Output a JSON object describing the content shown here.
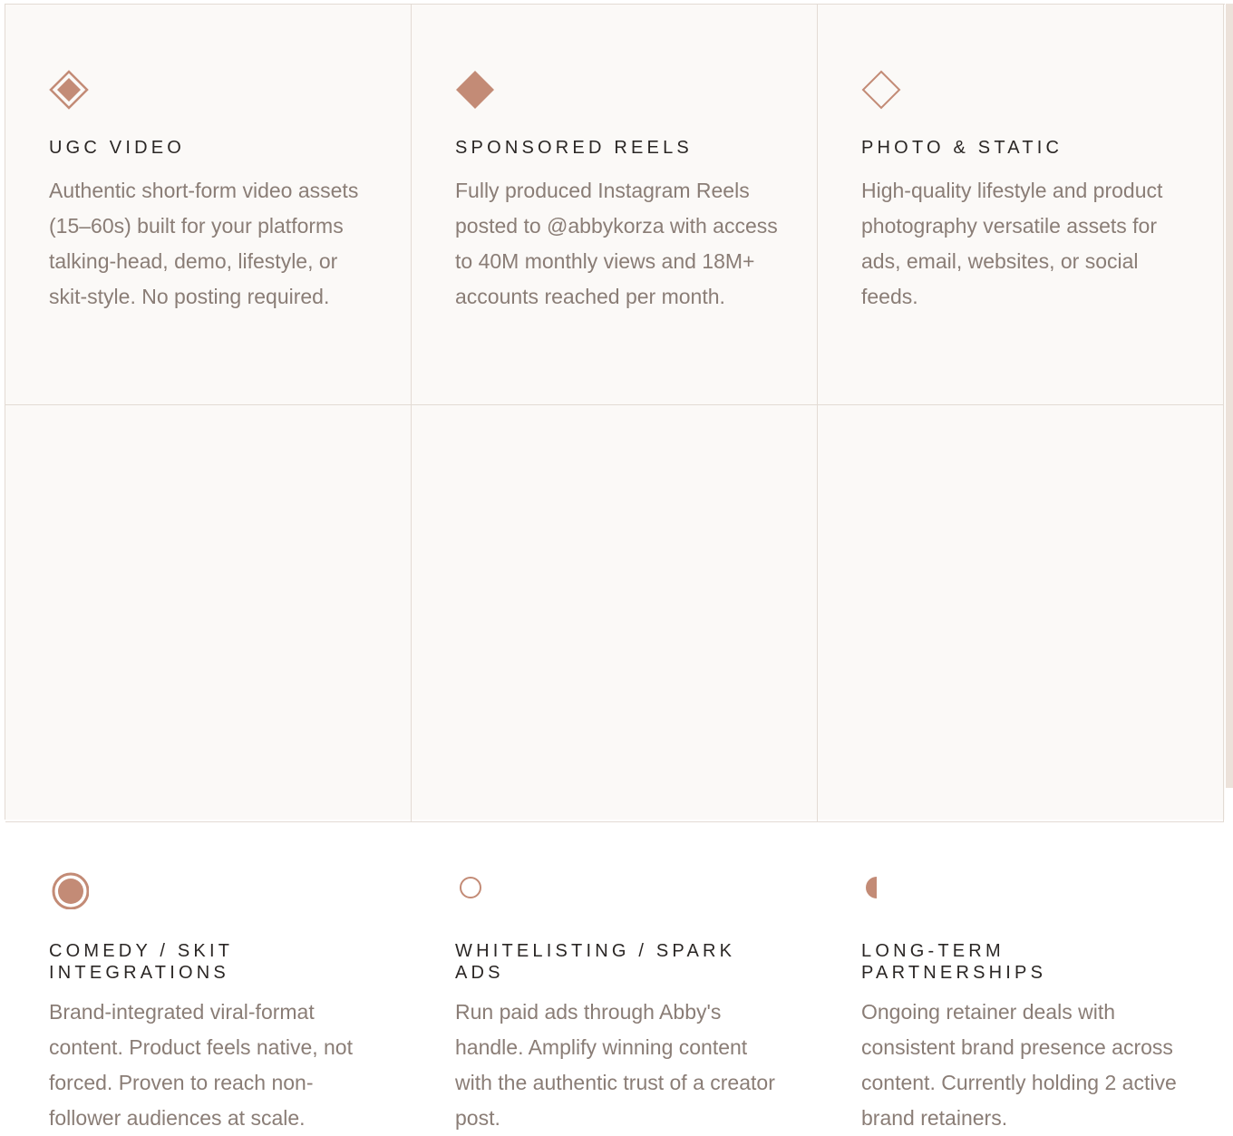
{
  "colors": {
    "accent": "#c38b76",
    "title": "#2a2624",
    "text": "#8a7d76",
    "background": "#fbf9f7",
    "border": "#e3dbd4"
  },
  "services": [
    {
      "icon": "diamond-outlined-icon",
      "title": "UGC VIDEO",
      "description": "Authentic short-form video assets (15–60s) built for your platforms talking-head, demo, lifestyle, or skit-style. No posting required."
    },
    {
      "icon": "diamond-filled-icon",
      "title": "SPONSORED REELS",
      "description": "Fully produced Instagram Reels posted to @abbykorza with access to 40M monthly views and 18M+ accounts reached per month."
    },
    {
      "icon": "diamond-outline-icon",
      "title": "PHOTO & STATIC",
      "description": "High-quality lifestyle and product photography versatile assets for ads, email, websites, or social feeds."
    },
    {
      "icon": "circle-target-icon",
      "title": "COMEDY / SKIT INTEGRATIONS",
      "description": "Brand-integrated viral-format content. Product feels native, not forced. Proven to reach non-follower audiences at scale."
    },
    {
      "icon": "circle-outline-icon",
      "title": "WHITELISTING / SPARK ADS",
      "description": "Run paid ads through Abby's handle. Amplify winning content with the authentic trust of a creator post."
    },
    {
      "icon": "half-circle-icon",
      "title": "LONG-TERM PARTNERSHIPS",
      "description": "Ongoing retainer deals with consistent brand presence across content. Currently holding 2 active brand retainers."
    }
  ]
}
